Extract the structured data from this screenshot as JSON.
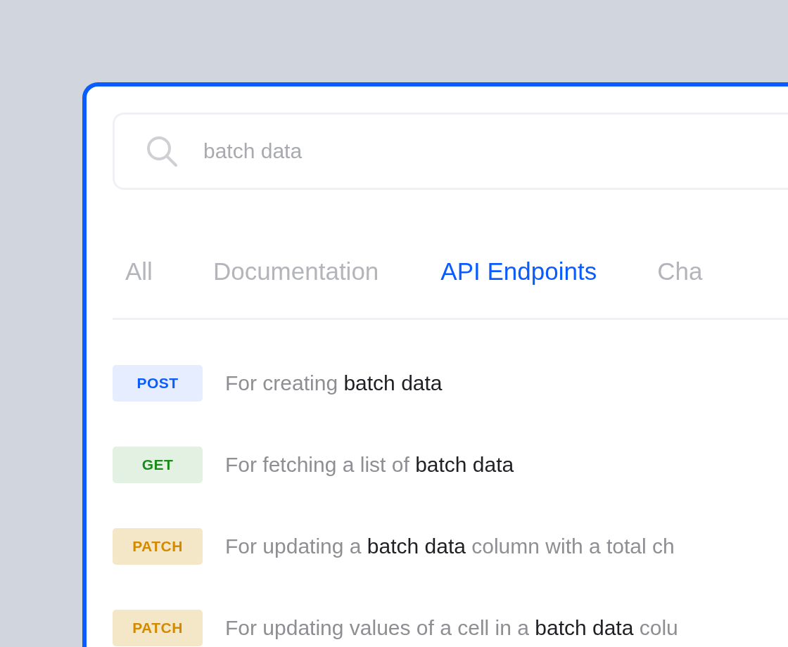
{
  "search": {
    "value": "batch data"
  },
  "tabs": [
    {
      "label": "All",
      "selected": false
    },
    {
      "label": "Documentation",
      "selected": false
    },
    {
      "label": "API Endpoints",
      "selected": true
    },
    {
      "label": "Cha",
      "selected": false
    }
  ],
  "results": [
    {
      "method": "POST",
      "kind": "post",
      "description": "For creating **batch data**"
    },
    {
      "method": "GET",
      "kind": "get",
      "description": "For fetching a list of **batch data**"
    },
    {
      "method": "PATCH",
      "kind": "patch",
      "description": "For updating a **batch data** column with a total ch"
    },
    {
      "method": "PATCH",
      "kind": "patch",
      "description": "For updating values of a cell in a **batch data** colu"
    }
  ]
}
